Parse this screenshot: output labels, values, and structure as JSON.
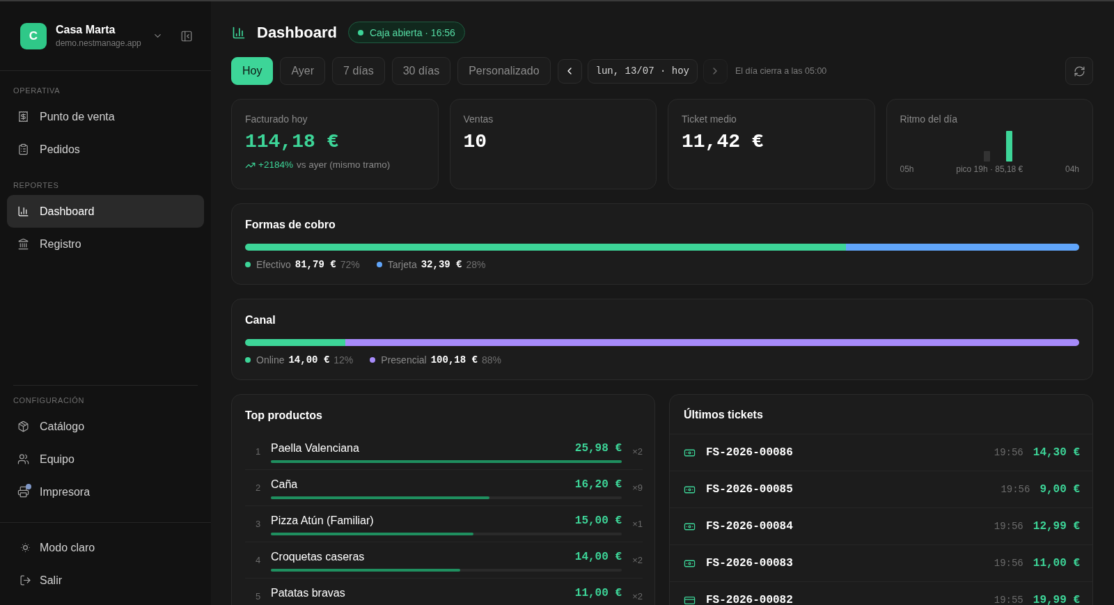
{
  "sidebar": {
    "workspace": {
      "initial": "C",
      "name": "Casa Marta",
      "domain": "demo.nestmanage.app"
    },
    "sections": [
      {
        "title": "OPERATIVA",
        "items": [
          {
            "label": "Punto de venta",
            "selected": false
          },
          {
            "label": "Pedidos",
            "selected": false
          }
        ]
      },
      {
        "title": "REPORTES",
        "items": [
          {
            "label": "Dashboard",
            "selected": true
          },
          {
            "label": "Registro",
            "selected": false
          }
        ]
      }
    ],
    "settings": {
      "title": "CONFIGURACIÓN",
      "items": [
        {
          "label": "Catálogo",
          "selected": false,
          "alert": false
        },
        {
          "label": "Equipo",
          "selected": false,
          "alert": false
        },
        {
          "label": "Impresora",
          "selected": false,
          "alert": true
        }
      ]
    },
    "footer": [
      {
        "label": "Modo claro"
      },
      {
        "label": "Salir"
      }
    ]
  },
  "header": {
    "title": "Dashboard",
    "status": "Caja abierta · 16:56"
  },
  "range_tabs": [
    {
      "label": "Hoy",
      "selected": true
    },
    {
      "label": "Ayer",
      "selected": false
    },
    {
      "label": "7 días",
      "selected": false
    },
    {
      "label": "30 días",
      "selected": false
    },
    {
      "label": "Personalizado",
      "selected": false
    }
  ],
  "date_nav": {
    "date": "lun, 13/07 · hoy",
    "next_disabled": true,
    "note": "El día cierra a las 05:00"
  },
  "kpis": [
    {
      "label": "Facturado hoy",
      "value": "114,18 €",
      "highlight": true,
      "trend": {
        "change": "+2184%",
        "note": "vs ayer (mismo tramo)"
      }
    },
    {
      "label": "Ventas",
      "value": "10",
      "highlight": false
    },
    {
      "label": "Ticket medio",
      "value": "11,42 €",
      "highlight": false
    }
  ],
  "rhythm": {
    "label": "Ritmo del día",
    "axis_start": "05h",
    "peak": "pico 19h · 85,18 €",
    "axis_end": "04h"
  },
  "breakdowns": [
    {
      "title": "Formas de cobro",
      "segments": [
        {
          "name": "Efectivo",
          "amount": "81,79 €",
          "percent": "72%",
          "level": 0.72,
          "color": "#3dd598"
        },
        {
          "name": "Tarjeta",
          "amount": "32,39 €",
          "percent": "28%",
          "level": 0.28,
          "color": "#60a5fa"
        }
      ]
    },
    {
      "title": "Canal",
      "segments": [
        {
          "name": "Online",
          "amount": "14,00 €",
          "percent": "12%",
          "level": 0.12,
          "color": "#3dd598"
        },
        {
          "name": "Presencial",
          "amount": "100,18 €",
          "percent": "88%",
          "level": 0.88,
          "color": "#a78bfa"
        }
      ]
    }
  ],
  "top_products": {
    "title": "Top productos",
    "rows": [
      {
        "rank": "1",
        "name": "Paella Valenciana",
        "amount": "25,98 €",
        "quantity": "×2",
        "level": 1.0
      },
      {
        "rank": "2",
        "name": "Caña",
        "amount": "16,20 €",
        "quantity": "×9",
        "level": 0.624
      },
      {
        "rank": "3",
        "name": "Pizza Atún (Familiar)",
        "amount": "15,00 €",
        "quantity": "×1",
        "level": 0.577
      },
      {
        "rank": "4",
        "name": "Croquetas caseras",
        "amount": "14,00 €",
        "quantity": "×2",
        "level": 0.539
      },
      {
        "rank": "5",
        "name": "Patatas bravas",
        "amount": "11,00 €",
        "quantity": "×2"
      }
    ]
  },
  "latest_tickets": {
    "title": "Últimos tickets",
    "rows": [
      {
        "kind": "cash",
        "id": "FS-2026-00086",
        "time": "19:56",
        "amount": "14,30 €"
      },
      {
        "kind": "cash",
        "id": "FS-2026-00085",
        "time": "19:56",
        "amount": "9,00 €"
      },
      {
        "kind": "cash",
        "id": "FS-2026-00084",
        "time": "19:56",
        "amount": "12,99 €"
      },
      {
        "kind": "cash",
        "id": "FS-2026-00083",
        "time": "19:56",
        "amount": "11,00 €"
      },
      {
        "kind": "card",
        "id": "FS-2026-00082",
        "time": "19:55",
        "amount": "19,99 €"
      }
    ]
  }
}
